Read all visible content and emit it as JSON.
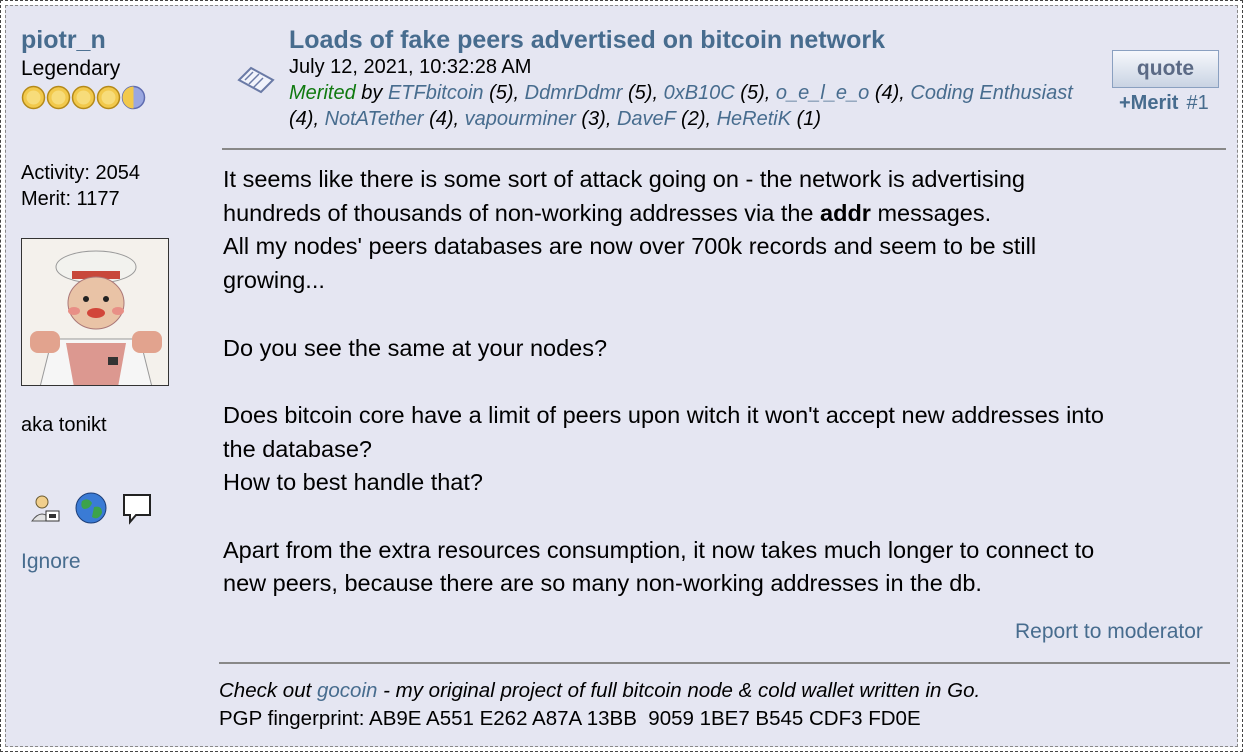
{
  "poster": {
    "name": "piotr_n",
    "rank": "Legendary",
    "activity": "Activity: 2054",
    "merit": "Merit: 1177",
    "personal_text": "aka tonikt",
    "ignore_label": "Ignore",
    "star_count": 5
  },
  "post": {
    "title": "Loads of fake peers advertised on bitcoin network",
    "date": "July 12, 2021, 10:32:28 AM",
    "merited_label": "Merited",
    "merited_by": " by ",
    "merits": [
      {
        "user": "ETFbitcoin",
        "count": " (5), "
      },
      {
        "user": "DdmrDdmr",
        "count": " (5), "
      },
      {
        "user": "0xB10C",
        "count": " (5), "
      },
      {
        "user": "o_e_l_e_o",
        "count": " (4), "
      },
      {
        "user": "Coding Enthusiast",
        "count": " (4), "
      },
      {
        "user": "NotATether",
        "count": " (4), "
      },
      {
        "user": "vapourminer",
        "count": " (3), "
      },
      {
        "user": "DaveF",
        "count": " (2), "
      },
      {
        "user": "HeRetiK",
        "count": " (1)"
      }
    ],
    "quote_label": "quote",
    "merit_label": "+Merit",
    "post_number": "#1",
    "body": {
      "p1a": "It seems like there is some sort of attack going on - the network is advertising",
      "p1b_pre": "hundreds of thousands of non-working addresses via the ",
      "p1b_bold": "addr",
      "p1b_post": " messages.",
      "p1c": "All my nodes' peers databases are now over 700k records and seem to be still",
      "p1d": "growing...",
      "p2": "Do you see the same at your nodes?",
      "p3a": "Does bitcoin core have a limit of peers upon witch it won't accept new addresses into",
      "p3b": "the database?",
      "p3c": "How to best handle that?",
      "p4a": "Apart from the extra resources consumption, it now takes much longer to connect to",
      "p4b": "new peers, because there are so many non-working addresses in the db."
    },
    "report_label": "Report to moderator"
  },
  "signature": {
    "pre": "Check out ",
    "link": "gocoin",
    "post": " - my original project of full bitcoin node & cold wallet written in Go.",
    "pgp": "PGP fingerprint: AB9E A551 E262 A87A 13BB  9059 1BE7 B545 CDF3 FD0E"
  },
  "colors": {
    "link": "#476c8e",
    "merited": "#107a10",
    "background": "#e5e6f2"
  }
}
